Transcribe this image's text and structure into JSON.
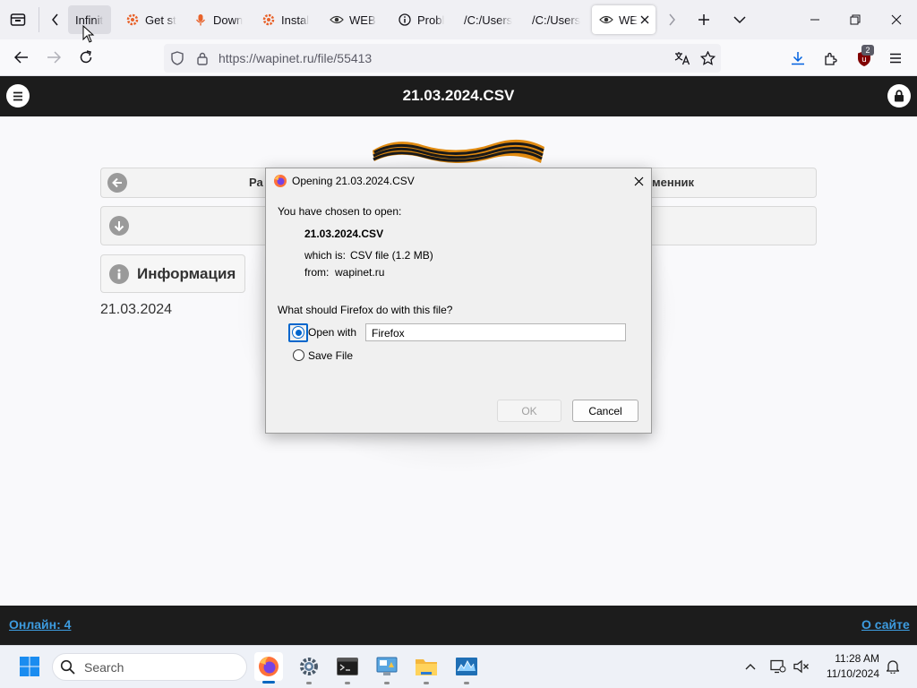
{
  "browser": {
    "tabs": [
      {
        "title": "Infinit",
        "state": "hovered"
      },
      {
        "title": "Get st"
      },
      {
        "title": "Down"
      },
      {
        "title": "Instal"
      },
      {
        "title": "WEB"
      },
      {
        "title": "Probl"
      },
      {
        "title": "/C:/Users"
      },
      {
        "title": "/C:/Users"
      },
      {
        "title": "WE",
        "state": "active"
      }
    ],
    "url": "https://wapinet.ru/file/55413",
    "extension_badge": "2"
  },
  "site": {
    "title": "21.03.2024.CSV",
    "button_left_partial": "Ра",
    "button_right_partial": "менник",
    "info_heading": "Информация",
    "date": "21.03.2024",
    "footer_online": "Онлайн: 4",
    "footer_about": "О сайте"
  },
  "dialog": {
    "title": "Opening 21.03.2024.CSV",
    "chosen_label": "You have chosen to open:",
    "filename": "21.03.2024.CSV",
    "which_is_label": "which is:",
    "which_is_value": "CSV file (1.2 MB)",
    "from_label": "from:",
    "from_value": "wapinet.ru",
    "question": "What should Firefox do with this file?",
    "open_with_label": "Open with",
    "open_with_value": "Firefox",
    "save_file_label": "Save File",
    "selected_option": "open_with",
    "ok_label": "OK",
    "cancel_label": "Cancel"
  },
  "taskbar": {
    "search_placeholder": "Search",
    "time": "11:28 AM",
    "date": "11/10/2024"
  },
  "colors": {
    "site_header": "#1c1c1c",
    "footer_link": "#3d9ce0",
    "firefox_orange": "#ff7139",
    "ublock_red": "#800000"
  }
}
